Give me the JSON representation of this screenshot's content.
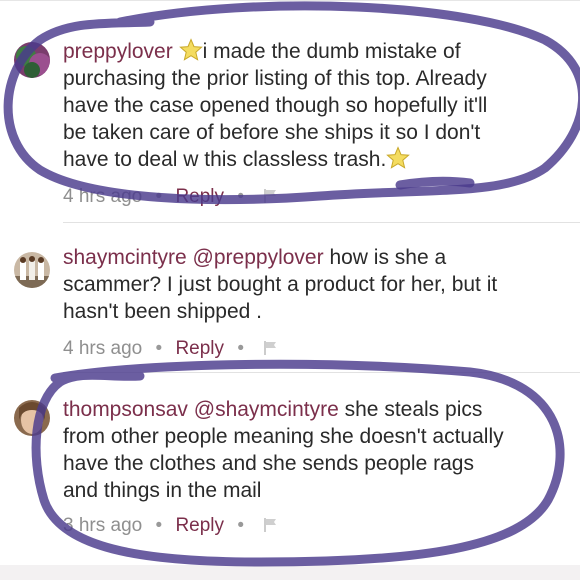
{
  "comments": [
    {
      "username": "preppylover",
      "lines": [
        "i made the dumb mistake of",
        "purchasing the prior listing of this top. Already",
        "have the case opened though so hopefully it'll",
        "be taken care of before she ships it so I don't",
        "have to deal w this classless trash."
      ],
      "time": "4 hrs ago",
      "reply": "Reply",
      "avatar_icon": "avatar-preppylover"
    },
    {
      "username": "shaymcintyre",
      "mention": "@preppylover",
      "lines": [
        "how is she a",
        "scammer? I just bought a product for her, but it",
        "hasn't been shipped ."
      ],
      "time": "4 hrs ago",
      "reply": "Reply",
      "avatar_icon": "avatar-shaymcintyre"
    },
    {
      "username": "thompsonsav",
      "mention": "@shaymcintyre",
      "lines": [
        "she steals pics",
        "from other people meaning she doesn't actually",
        "have the clothes and she sends people rags",
        "and things in the mail"
      ],
      "time": "3 hrs ago",
      "reply": "Reply",
      "avatar_icon": "avatar-thompsonsav"
    }
  ],
  "meta_separator": "•",
  "colors": {
    "username": "#7b2f4b",
    "annotation": "#4b3a8c",
    "meta": "#8f8f8f"
  },
  "icons": [
    "star-icon",
    "flag-icon"
  ]
}
